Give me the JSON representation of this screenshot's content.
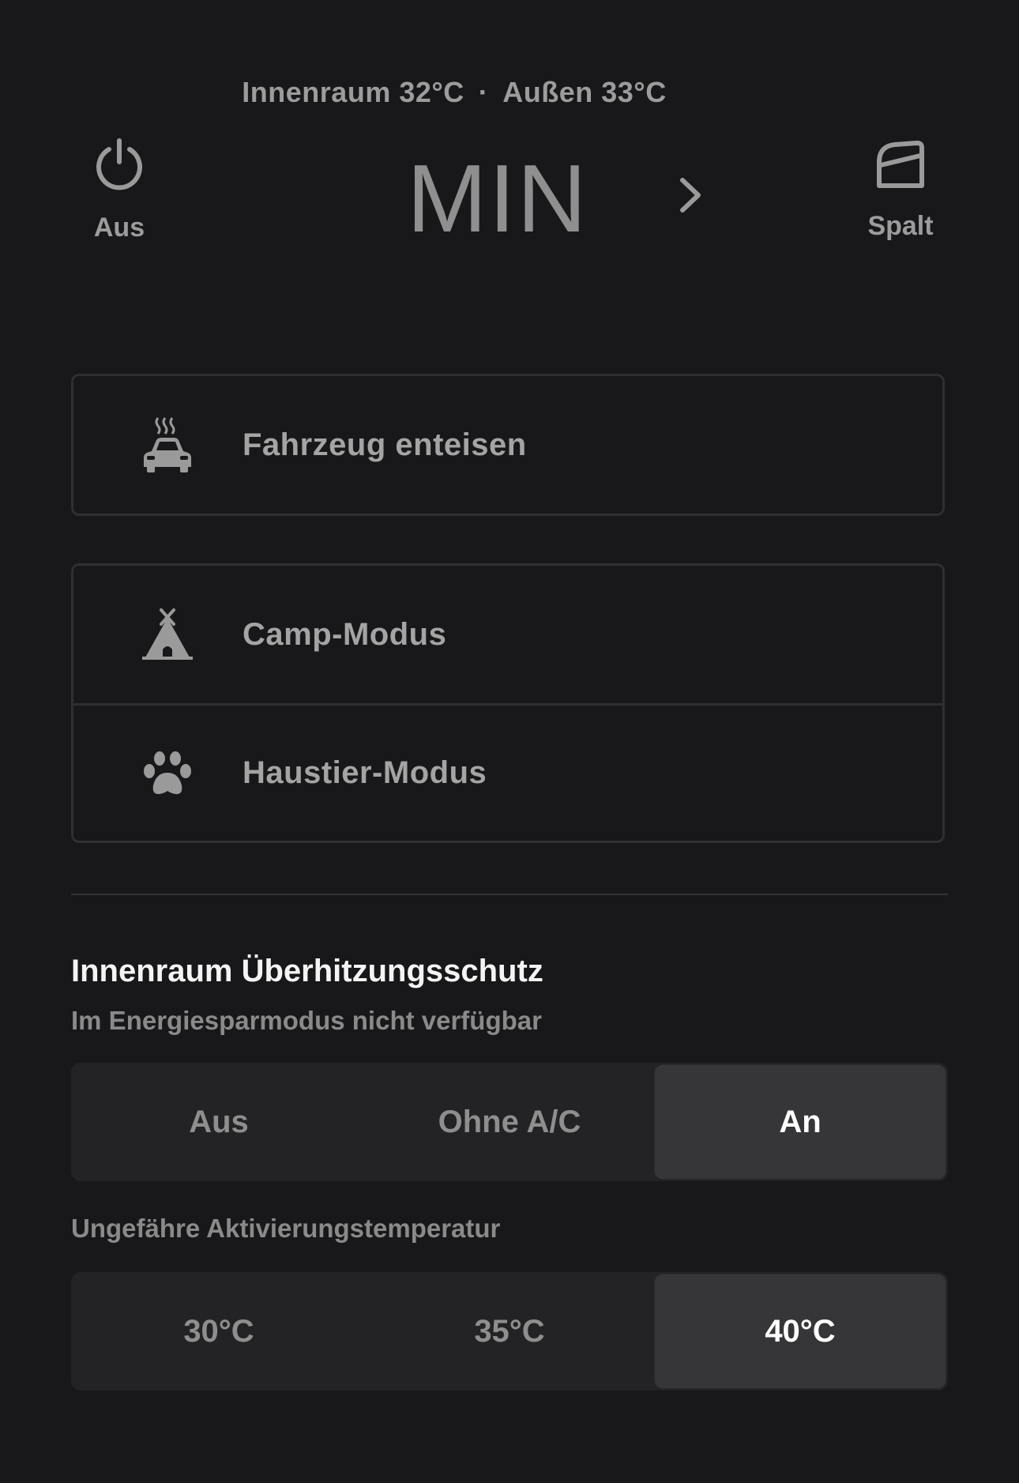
{
  "status": {
    "interior": "Innenraum 32°C",
    "separator": "·",
    "exterior": "Außen 33°C"
  },
  "power": {
    "icon": "power-icon",
    "label": "Aus"
  },
  "fan": {
    "level": "MIN",
    "chevron_icon": "chevron-right-icon"
  },
  "vent": {
    "icon": "window-vent-icon",
    "label": "Spalt"
  },
  "defrost": {
    "icon": "car-defrost-icon",
    "label": "Fahrzeug enteisen"
  },
  "modes": [
    {
      "icon": "tent-icon",
      "label": "Camp-Modus"
    },
    {
      "icon": "paw-icon",
      "label": "Haustier-Modus"
    }
  ],
  "overheat": {
    "title": "Innenraum Überhitzungsschutz",
    "subtitle": "Im Energiesparmodus nicht verfügbar",
    "options": [
      "Aus",
      "Ohne A/C",
      "An"
    ],
    "selected": "An",
    "temp_label": "Ungefähre Aktivierungstemperatur",
    "temp_options": [
      "30°C",
      "35°C",
      "40°C"
    ],
    "temp_selected": "40°C"
  },
  "colors": {
    "background": "#18181a",
    "active_segment": "#363638",
    "text_muted": "#9a9a9a",
    "text_bright": "#ffffff"
  }
}
